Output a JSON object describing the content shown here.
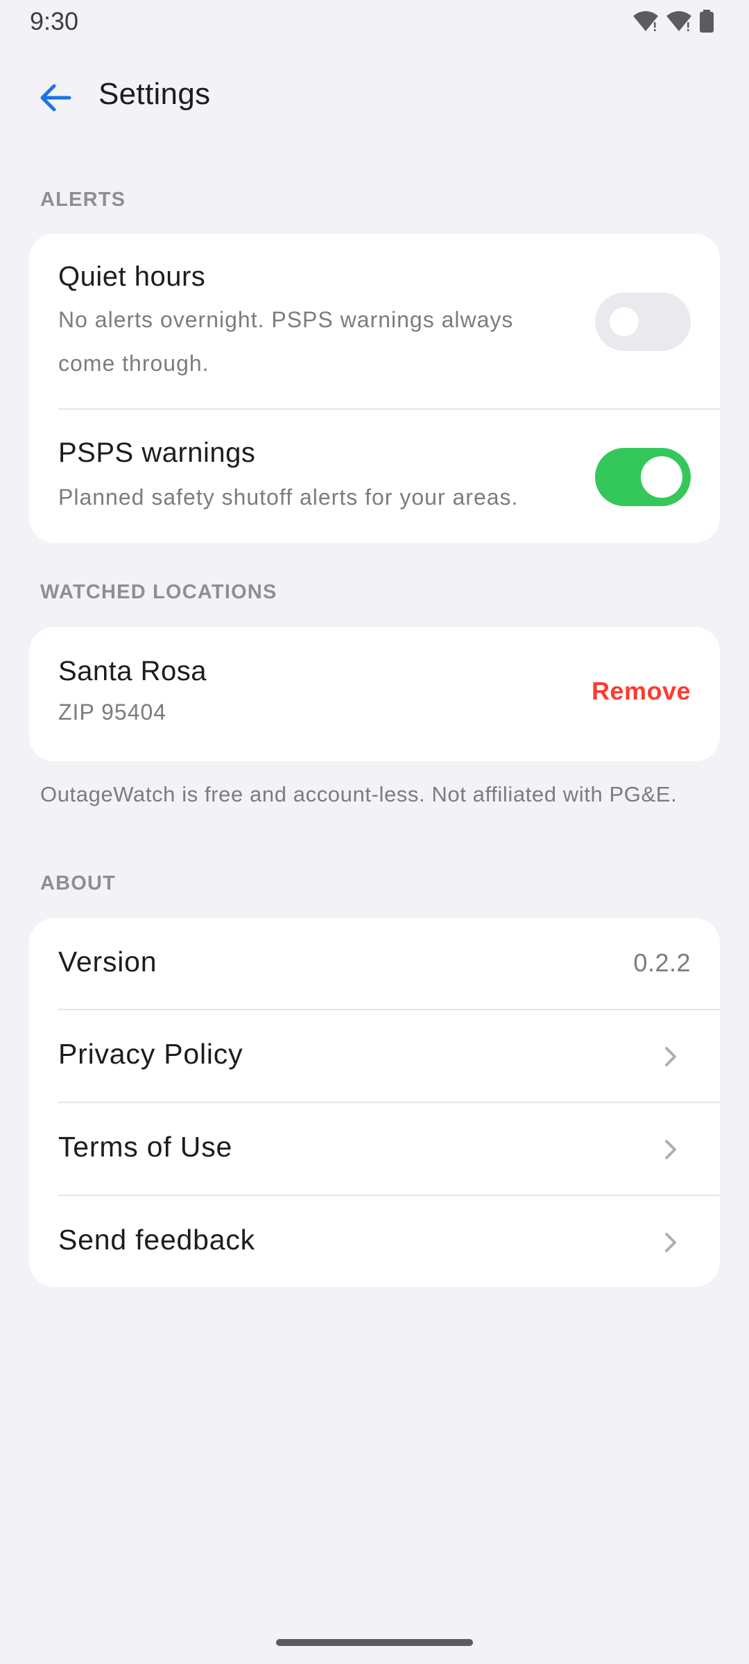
{
  "status_bar": {
    "time": "9:30"
  },
  "header": {
    "title": "Settings"
  },
  "alerts": {
    "section_label": "ALERTS",
    "quiet_hours": {
      "title": "Quiet hours",
      "subtitle_line1": "No alerts overnight. PSPS warnings always",
      "subtitle_line2": "come through.",
      "enabled": false
    },
    "psps": {
      "title": "PSPS warnings",
      "subtitle": "Planned safety shutoff alerts for your areas.",
      "enabled": true
    }
  },
  "locations": {
    "section_label": "WATCHED LOCATIONS",
    "items": [
      {
        "name": "Santa Rosa",
        "zip": "ZIP 95404",
        "action": "Remove"
      }
    ],
    "footnote": "OutageWatch is free and account-less. Not affiliated with PG&E."
  },
  "about": {
    "section_label": "ABOUT",
    "version_label": "Version",
    "version_value": "0.2.2",
    "privacy": "Privacy Policy",
    "terms": "Terms of Use",
    "feedback": "Send feedback"
  },
  "colors": {
    "accent": "#1a73e8",
    "toggle_on": "#34c759",
    "destructive": "#ff3b30",
    "background": "#f2f2f7"
  }
}
